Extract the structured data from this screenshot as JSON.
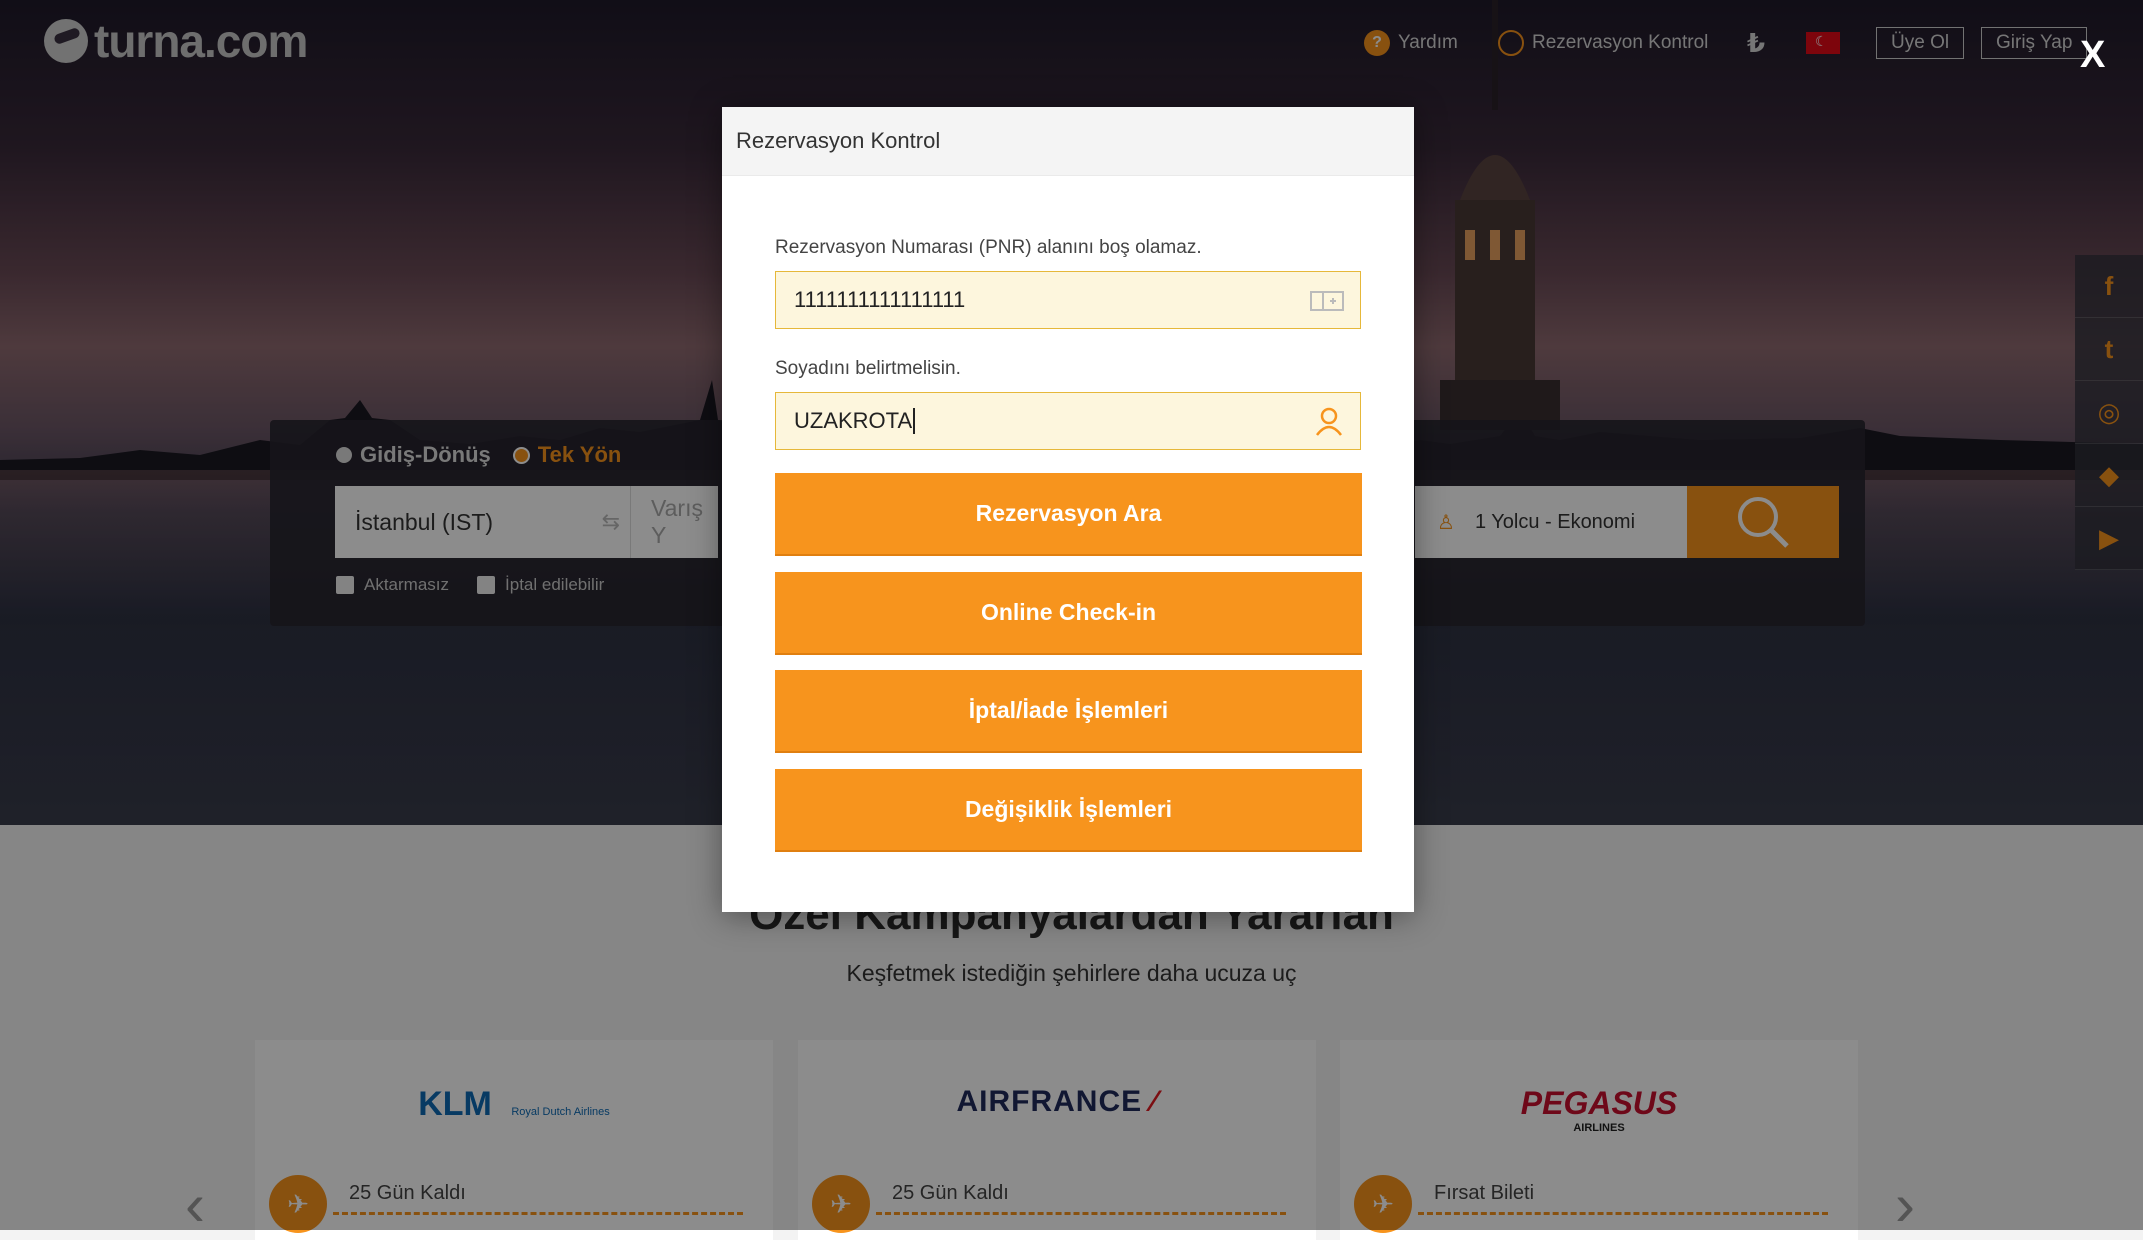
{
  "header": {
    "logo_text": "turna.com",
    "nav": {
      "help": "Yardım",
      "reservation_check": "Rezervasyon Kontrol",
      "currency_symbol": "₺",
      "signup": "Üye Ol",
      "login": "Giriş Yap"
    },
    "close_label": "X"
  },
  "search": {
    "trip_types": [
      "Gidiş-Dönüş",
      "Tek Yön"
    ],
    "selected_trip_type": "Tek Yön",
    "origin": "İstanbul (IST)",
    "destination_placeholder": "Varış Y",
    "passengers": "1 Yolcu - Ekonomi",
    "options": [
      "Aktarmasız",
      "İptal edilebilir"
    ]
  },
  "social": [
    "f",
    "t",
    "ig",
    "fs",
    "yt"
  ],
  "promo": {
    "title": "Özel Kampanyalardan Yararlan",
    "subtitle": "Keşfetmek istediğin şehirlere daha ucuza uç",
    "cards": [
      {
        "brand": "KLM",
        "brand_sub": "Royal Dutch Airlines",
        "status": "25 Gün Kaldı"
      },
      {
        "brand": "AIRFRANCE",
        "brand_sub": "",
        "status": "25 Gün Kaldı"
      },
      {
        "brand": "PEGASUS",
        "brand_sub": "AIRLINES",
        "status": "Fırsat Bileti"
      }
    ]
  },
  "modal": {
    "title": "Rezervasyon Kontrol",
    "pnr_error": "Rezervasyon Numarası (PNR) alanını boş olamaz.",
    "pnr_value": "1111111111111111",
    "surname_error": "Soyadını belirtmelisin.",
    "surname_value": "UZAKROTA",
    "buttons": {
      "search": "Rezervasyon Ara",
      "checkin": "Online Check-in",
      "cancel": "İptal/İade İşlemleri",
      "change": "Değişiklik İşlemleri"
    }
  },
  "colors": {
    "accent": "#f7941d",
    "input_bg": "#fdf6dd"
  }
}
